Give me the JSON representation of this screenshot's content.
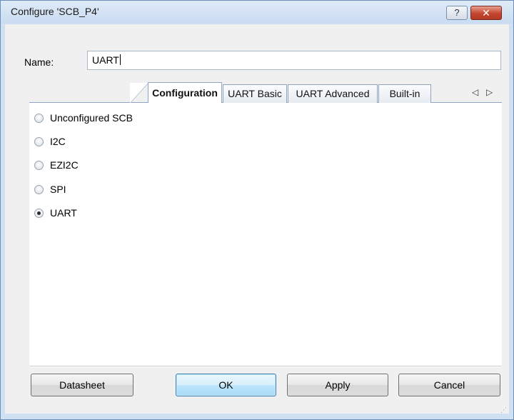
{
  "window": {
    "title": "Configure 'SCB_P4'",
    "help_label": "?",
    "close_label": "✕"
  },
  "name_field": {
    "label": "Name:",
    "value": "UART"
  },
  "tabs": [
    {
      "label": "Configuration",
      "active": true
    },
    {
      "label": "UART Basic",
      "active": false
    },
    {
      "label": "UART Advanced",
      "active": false
    },
    {
      "label": "Built-in",
      "active": false
    }
  ],
  "tab_scroll": {
    "left": "◁",
    "right": "▷"
  },
  "radio_options": [
    {
      "label": "Unconfigured SCB",
      "checked": false
    },
    {
      "label": "I2C",
      "checked": false
    },
    {
      "label": "EZI2C",
      "checked": false
    },
    {
      "label": "SPI",
      "checked": false
    },
    {
      "label": "UART",
      "checked": true
    }
  ],
  "buttons": {
    "datasheet": "Datasheet",
    "ok": "OK",
    "apply": "Apply",
    "cancel": "Cancel"
  },
  "colors": {
    "window_frame": "#cfe0f3",
    "close_button": "#c2462f",
    "default_button": "#bee6fd"
  }
}
